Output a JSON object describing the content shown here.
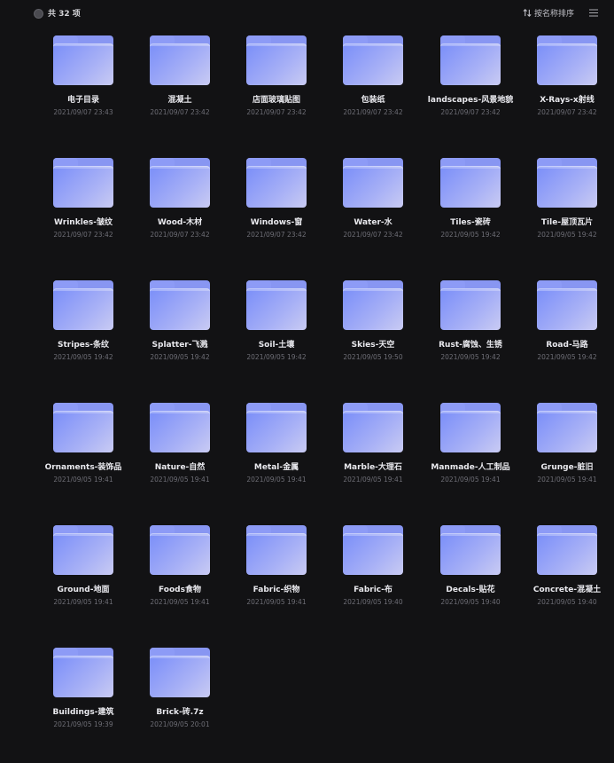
{
  "header": {
    "count_label": "共 32 项",
    "sort_label": "按名称排序",
    "sort_icon": "sort-arrows-icon",
    "menu_icon": "hamburger-menu-icon"
  },
  "colors": {
    "background": "#121214",
    "folder_accent": "#8896f2",
    "text": "#e9e9ee",
    "date_text": "#6e6e76"
  },
  "folders": [
    {
      "name": "电子目录",
      "date": "2021/09/07 23:43"
    },
    {
      "name": "混凝土",
      "date": "2021/09/07 23:42"
    },
    {
      "name": "店面玻璃贴图",
      "date": "2021/09/07 23:42"
    },
    {
      "name": "包装纸",
      "date": "2021/09/07 23:42"
    },
    {
      "name": "landscapes-风景地貌",
      "date": "2021/09/07 23:42"
    },
    {
      "name": "X-Rays-x射线",
      "date": "2021/09/07 23:42"
    },
    {
      "name": "Wrinkles-皱纹",
      "date": "2021/09/07 23:42"
    },
    {
      "name": "Wood-木材",
      "date": "2021/09/07 23:42"
    },
    {
      "name": "Windows-窗",
      "date": "2021/09/07 23:42"
    },
    {
      "name": "Water-水",
      "date": "2021/09/07 23:42"
    },
    {
      "name": "Tiles-瓷砖",
      "date": "2021/09/05 19:42"
    },
    {
      "name": "Tile-屋顶瓦片",
      "date": "2021/09/05 19:42"
    },
    {
      "name": "Stripes-条纹",
      "date": "2021/09/05 19:42"
    },
    {
      "name": "Splatter-飞溅",
      "date": "2021/09/05 19:42"
    },
    {
      "name": "Soil-土壤",
      "date": "2021/09/05 19:42"
    },
    {
      "name": "Skies-天空",
      "date": "2021/09/05 19:50"
    },
    {
      "name": "Rust-腐蚀、生锈",
      "date": "2021/09/05 19:42"
    },
    {
      "name": "Road-马路",
      "date": "2021/09/05 19:42"
    },
    {
      "name": "Ornaments-装饰品",
      "date": "2021/09/05 19:41"
    },
    {
      "name": "Nature-自然",
      "date": "2021/09/05 19:41"
    },
    {
      "name": "Metal-金属",
      "date": "2021/09/05 19:41"
    },
    {
      "name": "Marble-大理石",
      "date": "2021/09/05 19:41"
    },
    {
      "name": "Manmade-人工制品",
      "date": "2021/09/05 19:41"
    },
    {
      "name": "Grunge-脏旧",
      "date": "2021/09/05 19:41"
    },
    {
      "name": "Ground-地面",
      "date": "2021/09/05 19:41"
    },
    {
      "name": "Foods食物",
      "date": "2021/09/05 19:41"
    },
    {
      "name": "Fabric-织物",
      "date": "2021/09/05 19:41"
    },
    {
      "name": "Fabric-布",
      "date": "2021/09/05 19:40"
    },
    {
      "name": "Decals-贴花",
      "date": "2021/09/05 19:40"
    },
    {
      "name": "Concrete-混凝土",
      "date": "2021/09/05 19:40"
    },
    {
      "name": "Buildings-建筑",
      "date": "2021/09/05 19:39"
    },
    {
      "name": "Brick-砖.7z",
      "date": "2021/09/05 20:01"
    }
  ]
}
